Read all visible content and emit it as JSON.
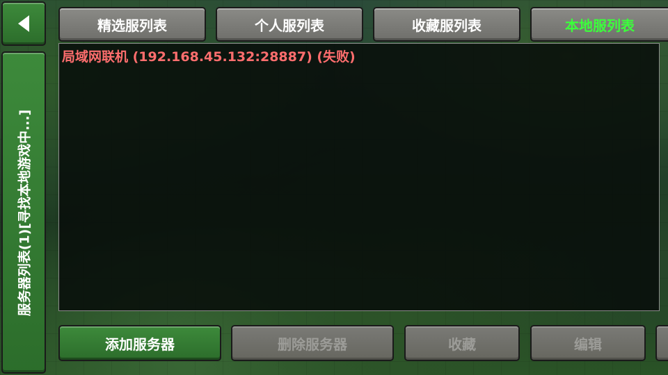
{
  "colors": {
    "active_tab": "#3bff3b",
    "server_failed": "#ff6e6e",
    "primary_button": "#2c6d2b",
    "default_button": "#7a7a76"
  },
  "back_button": {
    "icon": "back-arrow-icon"
  },
  "side_panel": {
    "label": "服务器列表(1)[寻找本地游戏中...]"
  },
  "tabs": [
    {
      "label": "精选服列表",
      "active": false
    },
    {
      "label": "个人服列表",
      "active": false
    },
    {
      "label": "收藏服列表",
      "active": false
    },
    {
      "label": "本地服列表",
      "active": true
    }
  ],
  "server_list": [
    {
      "label": "局域网联机 (192.168.45.132:28887) (失败)",
      "status": "failed"
    }
  ],
  "actions": {
    "add": "添加服务器",
    "delete": "删除服务器",
    "favorite": "收藏",
    "edit": "编辑"
  }
}
